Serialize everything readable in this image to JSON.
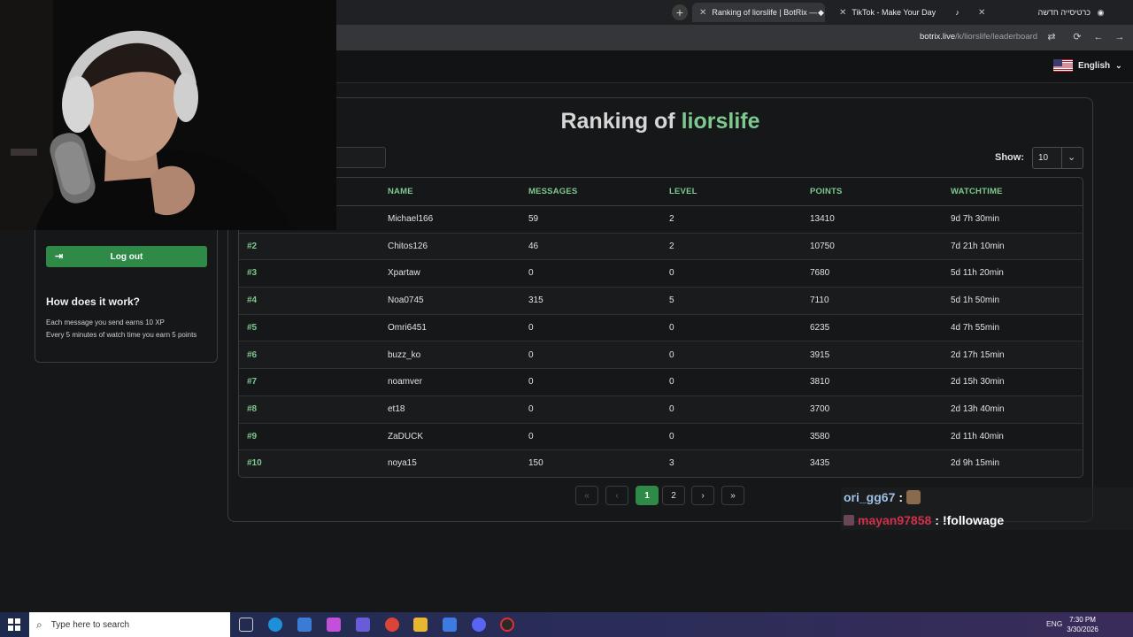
{
  "browser": {
    "tabs": [
      {
        "title": "Ranking of liorslife | BotRix — C",
        "active": true
      },
      {
        "title": "TikTok - Make Your Day",
        "active": false
      },
      {
        "title": "כרטיסייה חדשה",
        "active": false
      }
    ],
    "new_tab": "+",
    "url_host": "botrix.live",
    "url_path": "/k/liorslife/leaderboard"
  },
  "header": {
    "language": "English"
  },
  "sidebar": {
    "logout_label": "Log out",
    "how_title": "How does it work?",
    "how_lines": [
      "Each message you send earns 10 XP",
      "Every 5 minutes of watch time you earn 5 points"
    ]
  },
  "ranking": {
    "title_prefix": "Ranking of",
    "channel": "liorslife",
    "show_label": "Show:",
    "show_value": "10",
    "columns": [
      "NAME",
      "MESSAGES",
      "LEVEL",
      "POINTS",
      "WATCHTIME"
    ],
    "rows": [
      {
        "rank": "",
        "name": "Michael166",
        "messages": "59",
        "level": "2",
        "points": "13410",
        "watchtime": "9d 7h 30min"
      },
      {
        "rank": "#2",
        "name": "Chitos126",
        "messages": "46",
        "level": "2",
        "points": "10750",
        "watchtime": "7d 21h 10min"
      },
      {
        "rank": "#3",
        "name": "Xpartaw",
        "messages": "0",
        "level": "0",
        "points": "7680",
        "watchtime": "5d 11h 20min"
      },
      {
        "rank": "#4",
        "name": "Noa0745",
        "messages": "315",
        "level": "5",
        "points": "7110",
        "watchtime": "5d 1h 50min"
      },
      {
        "rank": "#5",
        "name": "Omri6451",
        "messages": "0",
        "level": "0",
        "points": "6235",
        "watchtime": "4d 7h 55min"
      },
      {
        "rank": "#6",
        "name": "buzz_ko",
        "messages": "0",
        "level": "0",
        "points": "3915",
        "watchtime": "2d 17h 15min"
      },
      {
        "rank": "#7",
        "name": "noamver",
        "messages": "0",
        "level": "0",
        "points": "3810",
        "watchtime": "2d 15h 30min"
      },
      {
        "rank": "#8",
        "name": "et18",
        "messages": "0",
        "level": "0",
        "points": "3700",
        "watchtime": "2d 13h 40min"
      },
      {
        "rank": "#9",
        "name": "ZaDUCK",
        "messages": "0",
        "level": "0",
        "points": "3580",
        "watchtime": "2d 11h 40min"
      },
      {
        "rank": "#10",
        "name": "noya15",
        "messages": "150",
        "level": "3",
        "points": "3435",
        "watchtime": "2d 9h 15min"
      }
    ],
    "pagination": {
      "first": "«",
      "prev": "‹",
      "pages": [
        "1",
        "2"
      ],
      "current_page": "1",
      "next": "›",
      "last": "»"
    }
  },
  "chat": [
    {
      "user": "ori_gg67",
      "sep": ":",
      "message": ""
    },
    {
      "user": "mayan97858",
      "sep": ":",
      "message": "!followage"
    }
  ],
  "taskbar": {
    "search_placeholder": "Type here to search",
    "language": "ENG",
    "time": "7:30 PM",
    "date": "3/30/2026"
  },
  "colors": {
    "accent": "#7ec98f",
    "button": "#2f8a47",
    "background": "#151718"
  }
}
